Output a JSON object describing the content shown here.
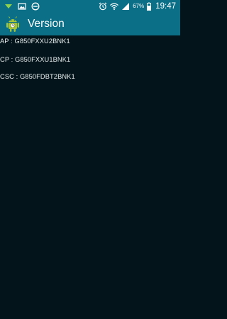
{
  "status_bar": {
    "battery_percent": "67%",
    "time": "19:47",
    "left_icons": [
      "wifi-notification-icon",
      "image-icon",
      "block-icon"
    ],
    "right_icons": [
      "alarm-icon",
      "wifi-icon",
      "signal-icon",
      "battery-icon"
    ]
  },
  "app_bar": {
    "title": "Version",
    "icon": "android-icon"
  },
  "info": {
    "ap": "AP : G850FXXU2BNK1",
    "cp": "CP : G850FXXU1BNK1",
    "csc": "CSC : G850FDBT2BNK1"
  },
  "colors": {
    "bar": "#0a6f87",
    "background": "#03151a",
    "text": "#e8eef0"
  }
}
